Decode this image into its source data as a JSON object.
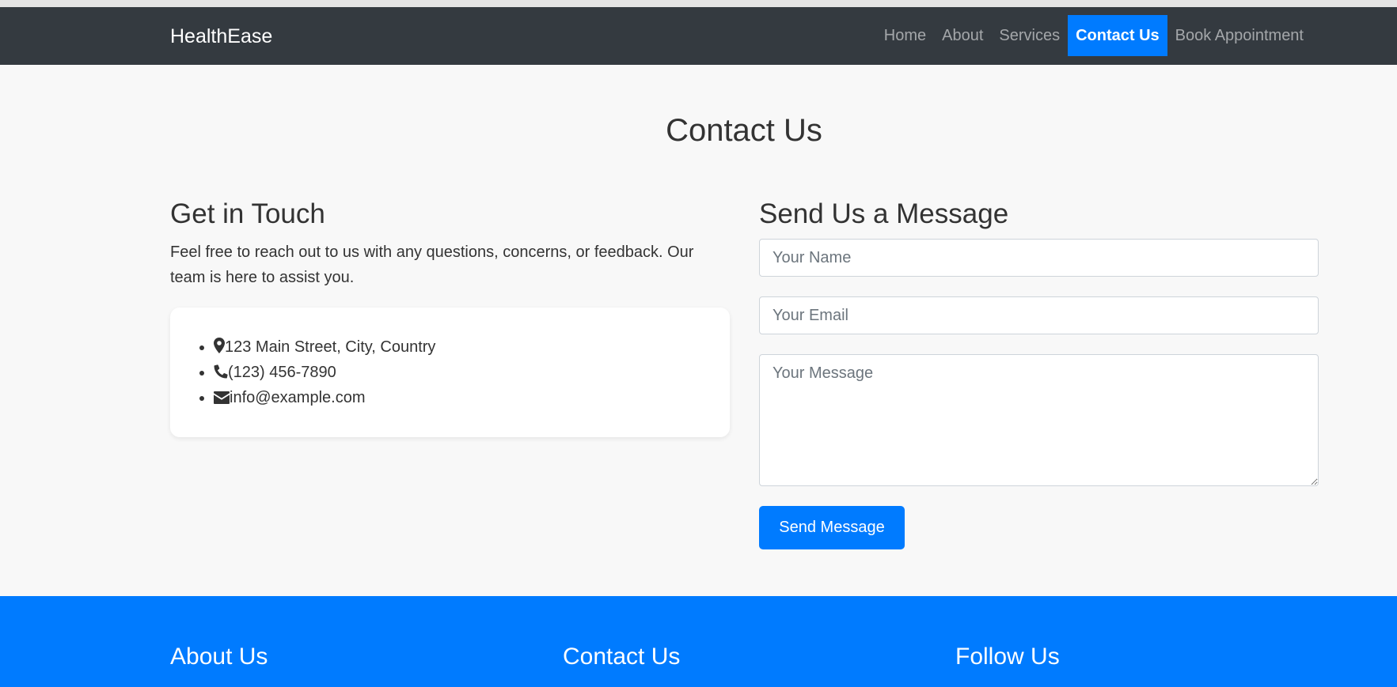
{
  "nav": {
    "brand": "HealthEase",
    "items": [
      {
        "label": "Home"
      },
      {
        "label": "About"
      },
      {
        "label": "Services"
      },
      {
        "label": "Contact Us",
        "active": true
      },
      {
        "label": "Book Appointment"
      }
    ]
  },
  "page": {
    "title": "Contact Us"
  },
  "get_in_touch": {
    "heading": "Get in Touch",
    "text": "Feel free to reach out to us with any questions, concerns, or feedback. Our team is here to assist you.",
    "items": [
      {
        "icon": "map-marker-icon",
        "text": "123 Main Street, City, Country"
      },
      {
        "icon": "phone-icon",
        "text": "(123) 456-7890"
      },
      {
        "icon": "envelope-icon",
        "text": "info@example.com"
      }
    ]
  },
  "form": {
    "heading": "Send Us a Message",
    "name_placeholder": "Your Name",
    "email_placeholder": "Your Email",
    "message_placeholder": "Your Message",
    "submit_label": "Send Message"
  },
  "footer": {
    "about_heading": "About Us",
    "contact_heading": "Contact Us",
    "follow_heading": "Follow Us"
  },
  "colors": {
    "navbar": "#343a40",
    "accent": "#007bff",
    "background": "#f8f8f8"
  }
}
